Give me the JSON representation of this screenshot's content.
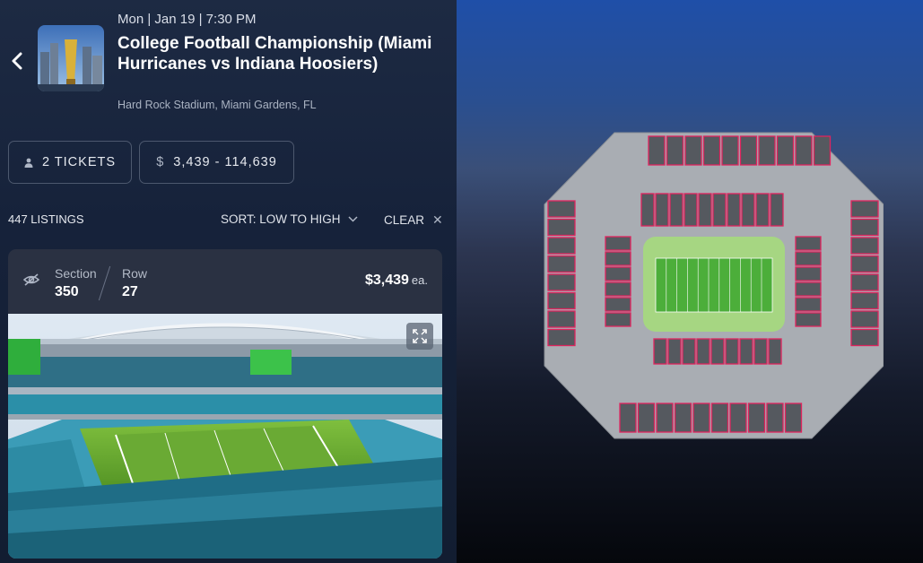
{
  "event": {
    "date": "Mon | Jan 19 | 7:30 PM",
    "title": "College Football Championship (Miami Hurricanes vs Indiana Hoosiers)",
    "venue": "Hard Rock Stadium, Miami Gardens, FL"
  },
  "filters": {
    "tickets_label": "2 TICKETS",
    "price_symbol": "$",
    "price_range": "3,439 - 114,639"
  },
  "listings": {
    "count_label": "447 LISTINGS",
    "sort_label": "SORT: LOW TO HIGH",
    "clear_label": "CLEAR"
  },
  "listing": {
    "section_label": "Section",
    "section_value": "350",
    "row_label": "Row",
    "row_value": "27",
    "price": "$3,439",
    "price_suffix": "ea."
  },
  "icons": {
    "back": "chevron-left-icon",
    "tickets": "person-icon",
    "price": "dollar-icon",
    "sort": "chevron-down-icon",
    "clear": "close-icon",
    "hide": "eye-off-icon",
    "expand": "expand-icon"
  },
  "colors": {
    "section_available": "#e0245e",
    "field_green": "#4cae3a",
    "panel_bg": "#1a2640",
    "card_bg": "#2a3142"
  }
}
